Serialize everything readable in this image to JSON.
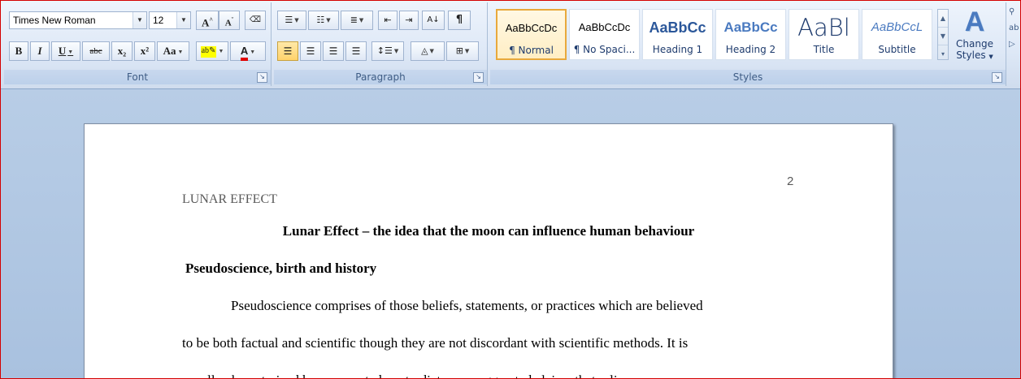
{
  "font_group": {
    "font_name": "Times New Roman",
    "font_size": "12",
    "grow_label": "A",
    "shrink_label": "A",
    "bold": "B",
    "italic": "I",
    "underline": "U",
    "strike": "abc",
    "subscript": "x₂",
    "superscript": "x²",
    "change_case": "Aa",
    "highlight": "ab",
    "font_color": "A",
    "label": "Font"
  },
  "paragraph_group": {
    "label": "Paragraph",
    "pilcrow": "¶"
  },
  "styles_group": {
    "label": "Styles",
    "items": [
      {
        "sample": "AaBbCcDc",
        "name": "¶ Normal"
      },
      {
        "sample": "AaBbCcDc",
        "name": "¶ No Spaci..."
      },
      {
        "sample": "AaBbCc",
        "name": "Heading 1"
      },
      {
        "sample": "AaBbCc",
        "name": "Heading 2"
      },
      {
        "sample": "AaBl",
        "name": "Title"
      },
      {
        "sample": "AaBbCcL",
        "name": "Subtitle"
      }
    ],
    "change_styles_line1": "Change",
    "change_styles_line2": "Styles"
  },
  "colors": {
    "accent": "#e8a93c",
    "heading": "#1f3c6e",
    "ribbon_label": "#3e5c85"
  },
  "document": {
    "page_number": "2",
    "running_head": "LUNAR EFFECT",
    "title": "Lunar Effect – the idea that the moon can influence human behaviour",
    "section_heading": "Pseudoscience, birth  and history",
    "lines": [
      "Pseudoscience comprises  of those beliefs, statements, or practices which are believed",
      "to be both factual and scientific though they are not discordant with scientific methods. It is",
      "usually characterized by unaccepted contradictory, exaggerated claims that relies on"
    ]
  }
}
